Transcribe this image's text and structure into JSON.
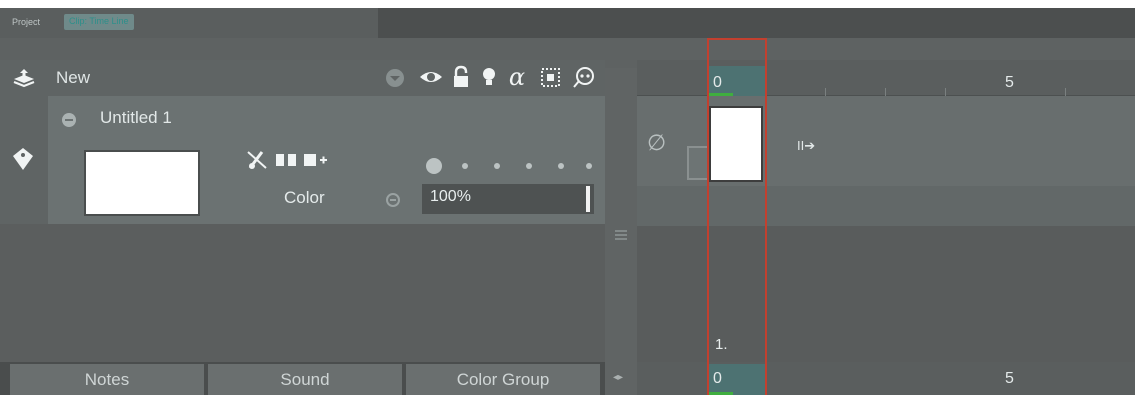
{
  "tabs": {
    "project": "Project",
    "clip_timeline": "Clip: Time Line"
  },
  "layer_header": {
    "new_label": "New",
    "icons": [
      "add-layer-icon",
      "dropdown-icon",
      "eye-icon",
      "lock-icon",
      "lightbulb-icon",
      "alpha-icon",
      "mask-icon",
      "onion-skin-icon"
    ]
  },
  "layer": {
    "name": "Untitled 1",
    "color_label": "Color",
    "opacity": "100%",
    "tool_icons": [
      "no-paint-icon",
      "mirror-icon",
      "add-frame-icon"
    ]
  },
  "bottom_tabs": [
    "Notes",
    "Sound",
    "Color Group"
  ],
  "timeline": {
    "ruler_labels": [
      "0",
      "5"
    ],
    "exposure": "1.",
    "current_frame": 0
  },
  "colors": {
    "panel_bg": "#5b5e5e",
    "playhead": "#c2402f",
    "frame_highlight": "#4d7272",
    "onion_green": "#3fae3f"
  }
}
